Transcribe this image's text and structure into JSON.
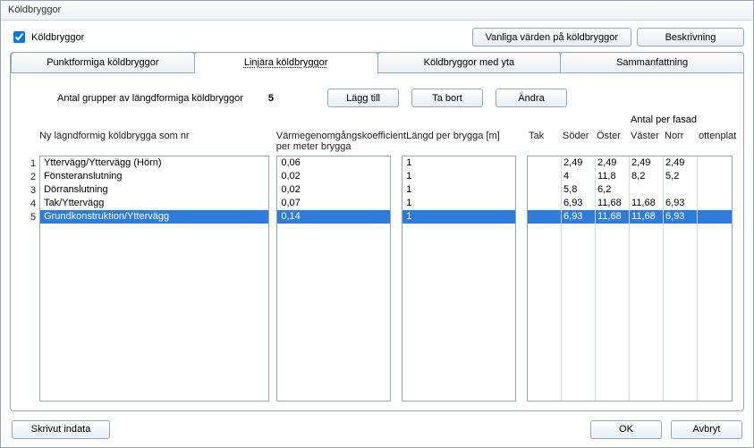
{
  "window": {
    "title": "Köldbryggor"
  },
  "checkbox": {
    "label": "Köldbryggor",
    "checked": true
  },
  "topButtons": {
    "defaults": "Vanliga värden på köldbryggor",
    "description": "Beskrivning"
  },
  "tabs": {
    "t1": "Punktformiga köldbryggor",
    "t2": "Linjära köldbryggor",
    "t3": "Köldbryggor med yta",
    "t4": "Sammanfattning",
    "activeIndex": 1
  },
  "control": {
    "label": "Antal grupper av längdformiga köldbryggor",
    "count": "5",
    "add": "Lägg till",
    "remove": "Ta bort",
    "edit": "Ändra"
  },
  "headers": {
    "name": "Ny lägndformig köldbrygga som nr",
    "coef": "Värmegenomgångskoefficient per meter brygga",
    "len": "Längd per brygga [m]",
    "fasadTitle": "Antal per fasad",
    "f1": "Tak",
    "f2": "Söder",
    "f3": "Öster",
    "f4": "Väster",
    "f5": "Norr",
    "f6": "ottenplat"
  },
  "rows": [
    {
      "n": "1",
      "name": "Yttervägg/Yttervägg (Hörn)",
      "coef": "0,06",
      "len": "1",
      "tak": "",
      "soder": "2,49",
      "oster": "2,49",
      "vaster": "2,49",
      "norr": "2,49",
      "otten": "",
      "sel": false
    },
    {
      "n": "2",
      "name": "Fönsteranslutning",
      "coef": "0,02",
      "len": "1",
      "tak": "",
      "soder": "4",
      "oster": "11,8",
      "vaster": "8,2",
      "norr": "5,2",
      "otten": "",
      "sel": false
    },
    {
      "n": "3",
      "name": "Dörranslutning",
      "coef": "0,02",
      "len": "1",
      "tak": "",
      "soder": "5,8",
      "oster": "6,2",
      "vaster": "",
      "norr": "",
      "otten": "",
      "sel": false
    },
    {
      "n": "4",
      "name": "Tak/Yttervägg",
      "coef": "0,07",
      "len": "1",
      "tak": "",
      "soder": "6,93",
      "oster": "11,68",
      "vaster": "11,68",
      "norr": "6,93",
      "otten": "",
      "sel": false
    },
    {
      "n": "5",
      "name": "Grundkonstruktion/Yttervägg",
      "coef": "0,14",
      "len": "1",
      "tak": "",
      "soder": "6,93",
      "oster": "11,68",
      "vaster": "11,68",
      "norr": "6,93",
      "otten": "",
      "sel": true
    }
  ],
  "footer": {
    "print": "Skrivut indata",
    "ok": "OK",
    "cancel": "Avbryt"
  }
}
